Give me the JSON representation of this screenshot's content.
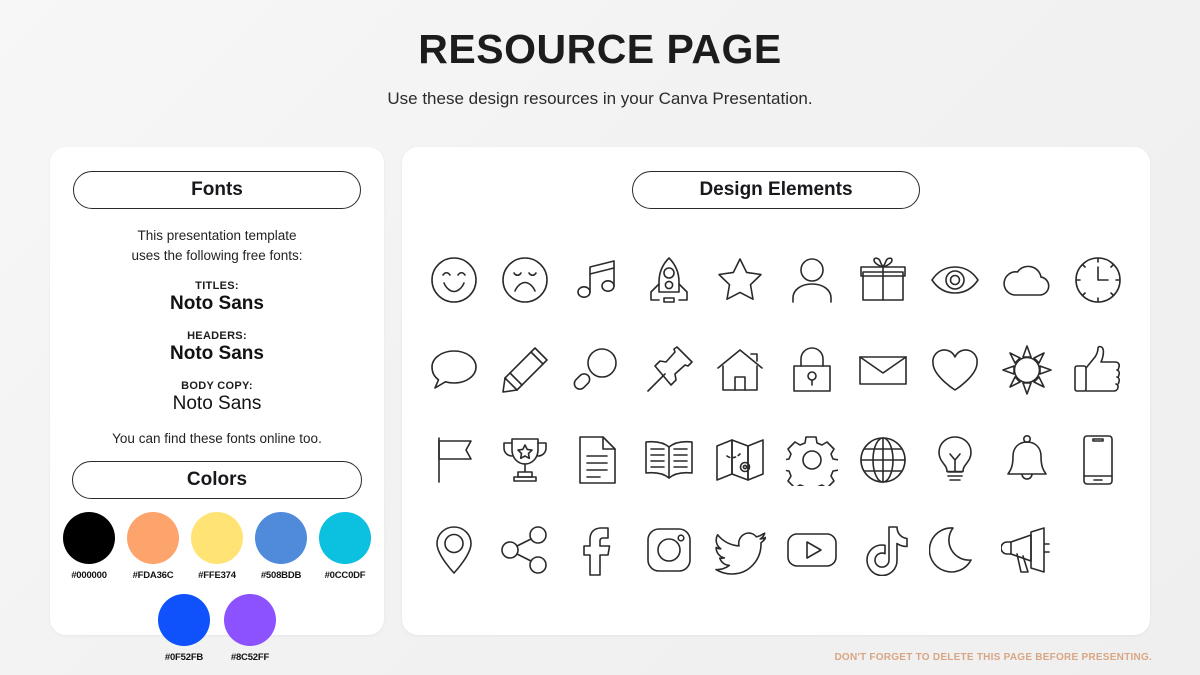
{
  "header": {
    "title": "RESOURCE PAGE",
    "subtitle": "Use these design resources in your Canva Presentation."
  },
  "fonts_panel": {
    "heading": "Fonts",
    "intro_line1": "This presentation template",
    "intro_line2": "uses the following free fonts:",
    "groups": [
      {
        "label": "TITLES:",
        "font": "Noto Sans",
        "weight": "bold"
      },
      {
        "label": "HEADERS:",
        "font": "Noto Sans",
        "weight": "bold"
      },
      {
        "label": "BODY COPY:",
        "font": "Noto Sans",
        "weight": "regular"
      }
    ],
    "outro": "You can find these fonts online too."
  },
  "colors_panel": {
    "heading": "Colors",
    "row1": [
      {
        "hex": "#000000",
        "label": "#000000"
      },
      {
        "hex": "#FDA36C",
        "label": "#FDA36C"
      },
      {
        "hex": "#FFE374",
        "label": "#FFE374"
      },
      {
        "hex": "#508BDB",
        "label": "#508BDB"
      },
      {
        "hex": "#0CC0DF",
        "label": "#0CC0DF"
      }
    ],
    "row2": [
      {
        "hex": "#0F52FB",
        "label": "#0F52FB"
      },
      {
        "hex": "#8C52FF",
        "label": "#8C52FF"
      }
    ]
  },
  "elements_panel": {
    "heading": "Design Elements",
    "icons": [
      "smiley-face-icon",
      "sad-face-icon",
      "music-note-icon",
      "rocket-icon",
      "star-icon",
      "person-icon",
      "gift-icon",
      "eye-icon",
      "cloud-icon",
      "clock-icon",
      "speech-bubble-icon",
      "pencil-icon",
      "magnifying-glass-icon",
      "pushpin-icon",
      "house-icon",
      "lock-icon",
      "envelope-icon",
      "heart-icon",
      "sun-icon",
      "thumbs-up-icon",
      "flag-icon",
      "trophy-icon",
      "document-icon",
      "open-book-icon",
      "map-icon",
      "gear-icon",
      "globe-icon",
      "lightbulb-icon",
      "bell-icon",
      "smartphone-icon",
      "location-pin-icon",
      "share-icon",
      "facebook-icon",
      "instagram-icon",
      "twitter-icon",
      "youtube-icon",
      "tiktok-icon",
      "moon-icon",
      "megaphone-icon"
    ]
  },
  "footer": {
    "note": "DON'T FORGET TO DELETE THIS PAGE BEFORE PRESENTING.",
    "note_color": "#d9a683"
  }
}
